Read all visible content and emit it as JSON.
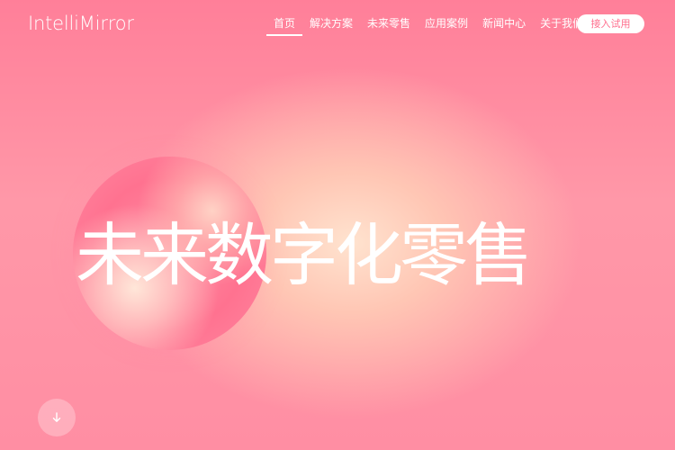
{
  "header": {
    "logo": "IntelliMirror",
    "nav": [
      "首页",
      "解决方案",
      "未来零售",
      "应用案例",
      "新闻中心",
      "关于我们"
    ],
    "cta": "接入试用"
  },
  "hero": {
    "title": "未来数字化零售"
  },
  "icons": {
    "scroll": "down-arrow-icon"
  },
  "colors": {
    "accent": "#ff6f8e",
    "background": "#ff8ea3"
  }
}
